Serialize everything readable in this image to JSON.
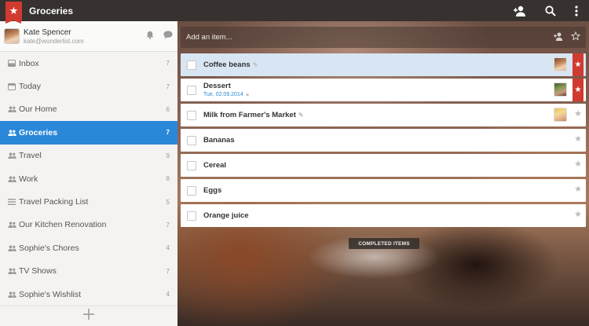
{
  "app": {
    "title": "Groceries"
  },
  "profile": {
    "name": "Kate Spencer",
    "email": "kate@wunderlist.com"
  },
  "sidebar": {
    "items": [
      {
        "label": "Inbox",
        "count": "7",
        "icon": "inbox-icon"
      },
      {
        "label": "Today",
        "count": "7",
        "icon": "calendar-icon"
      },
      {
        "label": "Our Home",
        "count": "6",
        "icon": "people-icon"
      },
      {
        "label": "Groceries",
        "count": "7",
        "icon": "people-icon",
        "active": true
      },
      {
        "label": "Travel",
        "count": "9",
        "icon": "people-icon"
      },
      {
        "label": "Work",
        "count": "8",
        "icon": "people-icon"
      },
      {
        "label": "Travel Packing List",
        "count": "5",
        "icon": "list-icon"
      },
      {
        "label": "Our Kitchen Renovation",
        "count": "7",
        "icon": "people-icon"
      },
      {
        "label": "Sophie's Chores",
        "count": "4",
        "icon": "people-icon"
      },
      {
        "label": "TV Shows",
        "count": "7",
        "icon": "people-icon"
      },
      {
        "label": "Sophie's Wishlist",
        "count": "4",
        "icon": "people-icon"
      }
    ]
  },
  "add_bar": {
    "placeholder": "Add an item..."
  },
  "tasks": [
    {
      "title": "Coffee beans",
      "date": "",
      "assignee": "kate-avatar",
      "starred": true,
      "selected": true
    },
    {
      "title": "Dessert",
      "date": "Tue, 02.09.2014",
      "assignee": "man-avatar",
      "starred": true
    },
    {
      "title": "Milk from Farmer's Market",
      "date": "",
      "assignee": "blonde-avatar",
      "starred": false
    },
    {
      "title": "Bananas",
      "date": "",
      "starred": false
    },
    {
      "title": "Cereal",
      "date": "",
      "starred": false
    },
    {
      "title": "Eggs",
      "date": "",
      "starred": false
    },
    {
      "title": "Orange juice",
      "date": "",
      "starred": false
    }
  ],
  "completed": {
    "label": "COMPLETED ITEMS"
  },
  "colors": {
    "accent": "#2b88d9",
    "brand": "#d13a2f",
    "topbar": "#37322f"
  }
}
